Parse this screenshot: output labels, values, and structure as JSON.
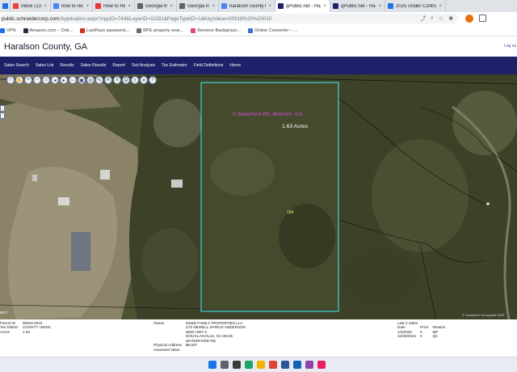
{
  "browser": {
    "tabs": [
      {
        "label": "pt",
        "icon": "document-icon",
        "color": "#1a73e8",
        "active": false
      },
      {
        "label": "Inbox (13) - tripleo",
        "icon": "mail-icon",
        "color": "#ea4335",
        "active": false
      },
      {
        "label": "how to record your",
        "icon": "google-icon",
        "color": "#4285f4",
        "active": false
      },
      {
        "label": "How to Record You",
        "icon": "video-icon",
        "color": "#e53935",
        "active": false
      },
      {
        "label": "Georgia MLS",
        "icon": "globe-icon",
        "color": "#5f6368",
        "active": false
      },
      {
        "label": "Georgia MLS",
        "icon": "globe-icon",
        "color": "#5f6368",
        "active": false
      },
      {
        "label": "haralson county ta",
        "icon": "search-icon",
        "color": "#4285f4",
        "active": false
      },
      {
        "label": "qPublic.net - Hara",
        "icon": "qpublic-icon",
        "color": "#1c2169",
        "active": true
      },
      {
        "label": "qPublic.net - Hara",
        "icon": "qpublic-icon",
        "color": "#1c2169",
        "active": false
      },
      {
        "label": "2025 Under Contra",
        "icon": "shield-icon",
        "color": "#1a73e8",
        "active": false
      }
    ],
    "url_host": "public.schneidercorp.com",
    "url_path": "/Application.aspx?AppID=744&LayerID=11181&PageTypeID=1&KeyValue=00918%20%20010",
    "bookmarks": [
      {
        "label": "VPN",
        "color": "#1a73e8"
      },
      {
        "label": "Amazon.com – Onli...",
        "color": "#232f3e"
      },
      {
        "label": "LastPass password...",
        "color": "#d32d27"
      },
      {
        "label": "BPE property sear...",
        "color": "#6b6b6b"
      },
      {
        "label": "Remove Backgroun...",
        "color": "#e0457b"
      },
      {
        "label": "Online Converter – ...",
        "color": "#3b6fd1"
      }
    ]
  },
  "header": {
    "title": "Haralson County, GA",
    "logout_label": "Log ou"
  },
  "nav": {
    "items": [
      "Sales Search",
      "Sales List",
      "Results",
      "Sales Results",
      "Report",
      "Soil Analysis",
      "Tax Estimator",
      "Field Definitions",
      "Home"
    ]
  },
  "map": {
    "parcel_address": "0 Waterford Rd, Bremen, GA",
    "acreage": "1.63 Acres",
    "parcel_number": "184",
    "scale_label": "80 ft",
    "copyright": "© Schneider Geospatial 2025",
    "parcel_outline_color": "#3fd6d6"
  },
  "info": {
    "left_labels": [
      "Parcel ID",
      "Tax District",
      "Acres"
    ],
    "left_values": [
      "00918 0010",
      "COUNTY UNINC",
      "1.63"
    ],
    "owner_label": "Owner",
    "owner_lines": [
      "DD&D FAMILY PROPERTIES LLC",
      "C/O NEWELL DARIUS ANDERSON",
      "6550 HWY 5",
      "DOUGLASVILLE, GA 30135",
      "WATERFORD RD"
    ],
    "physical_address_label": "Physical Address",
    "assessed_value_label": "Assessed Value",
    "assessed_value": "$6,507",
    "sales_title": "Last 2 Sales",
    "sales_headers": [
      "Date",
      "Price",
      "Reason"
    ],
    "sales_rows": [
      [
        "1/3/2025",
        "0",
        "MP"
      ],
      [
        "10/29/2024",
        "0",
        "QC"
      ]
    ]
  },
  "taskbar": {
    "icons": [
      {
        "name": "start-icon",
        "color": "#1a73e8"
      },
      {
        "name": "search-icon",
        "color": "#5f6368"
      },
      {
        "name": "task-view-icon",
        "color": "#3b3b3b"
      },
      {
        "name": "edge-icon",
        "color": "#1fa463"
      },
      {
        "name": "file-explorer-icon",
        "color": "#f2b600"
      },
      {
        "name": "chrome-icon",
        "color": "#db4437"
      },
      {
        "name": "store-icon",
        "color": "#2b579a"
      },
      {
        "name": "outlook-icon",
        "color": "#0f62b5"
      },
      {
        "name": "photos-icon",
        "color": "#8e44ad"
      },
      {
        "name": "snip-icon",
        "color": "#e91e63"
      }
    ]
  }
}
